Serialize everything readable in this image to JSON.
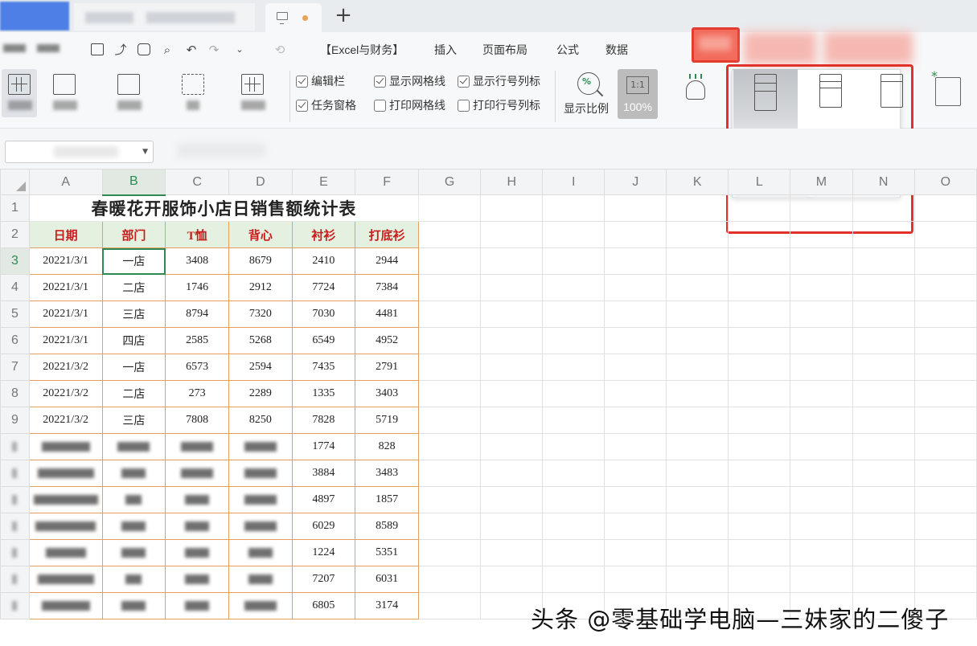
{
  "ribbon": {
    "menus": [
      "【Excel与财务】",
      "插入",
      "页面布局",
      "公式",
      "数据"
    ],
    "checkboxes": [
      {
        "label": "编辑栏",
        "checked": true
      },
      {
        "label": "显示网格线",
        "checked": true
      },
      {
        "label": "显示行号列标",
        "checked": true
      },
      {
        "label": "任务窗格",
        "checked": true
      },
      {
        "label": "打印网格线",
        "checked": false
      },
      {
        "label": "打印行号列标",
        "checked": false
      }
    ],
    "zoom_label": "显示比例",
    "zoom_ratio_icon": "1:1",
    "zoom_percent": "100%",
    "accent_color": "#2d8a52",
    "highlight_color": "#e0312a"
  },
  "sheet": {
    "columns": [
      "A",
      "B",
      "C",
      "D",
      "E",
      "F",
      "G",
      "H",
      "I",
      "J",
      "K",
      "L",
      "M",
      "N",
      "O"
    ],
    "selected_column": "B",
    "selected_row": "3",
    "title": "春暖花开服饰小店日销售额统计表",
    "headers": [
      "日期",
      "部门",
      "T恤",
      "背心",
      "衬衫",
      "打底衫"
    ],
    "rows": [
      {
        "rownum": "3",
        "cells": [
          "20221/3/1",
          "一店",
          "3408",
          "8679",
          "2410",
          "2944"
        ]
      },
      {
        "rownum": "4",
        "cells": [
          "20221/3/1",
          "二店",
          "1746",
          "2912",
          "7724",
          "7384"
        ]
      },
      {
        "rownum": "5",
        "cells": [
          "20221/3/1",
          "三店",
          "8794",
          "7320",
          "7030",
          "4481"
        ]
      },
      {
        "rownum": "6",
        "cells": [
          "20221/3/1",
          "四店",
          "2585",
          "5268",
          "6549",
          "4952"
        ]
      },
      {
        "rownum": "7",
        "cells": [
          "20221/3/2",
          "一店",
          "6573",
          "2594",
          "7435",
          "2791"
        ]
      },
      {
        "rownum": "8",
        "cells": [
          "20221/3/2",
          "二店",
          "273",
          "2289",
          "1335",
          "3403"
        ]
      },
      {
        "rownum": "9",
        "cells": [
          "20221/3/2",
          "三店",
          "7808",
          "8250",
          "7828",
          "5719"
        ]
      }
    ],
    "partial_rows": [
      {
        "e": "1774",
        "f": "828"
      },
      {
        "e": "3884",
        "f": "3483"
      },
      {
        "e": "4897",
        "f": "1857"
      },
      {
        "e": "6029",
        "f": "8589"
      },
      {
        "e": "1224",
        "f": "5351"
      },
      {
        "e": "7207",
        "f": "6031"
      },
      {
        "e": "6805",
        "f": "3174"
      }
    ]
  },
  "watermark": "头条 @零基础学电脑—三妹家的二傻子"
}
